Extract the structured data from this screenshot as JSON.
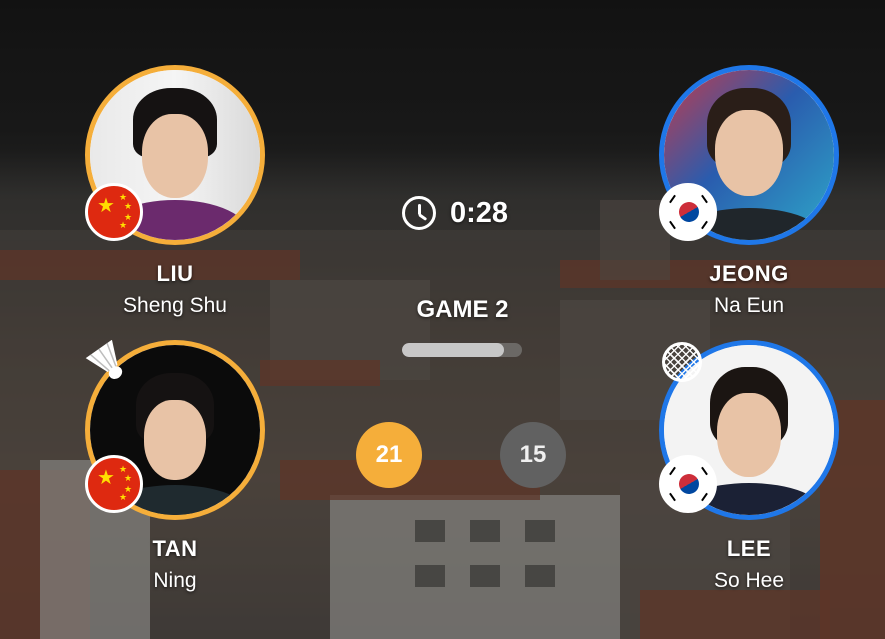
{
  "match": {
    "timer": "0:28",
    "game_label": "GAME 2",
    "game_progress_fraction": 0.85
  },
  "team_a": {
    "score": "21",
    "score_color": "#f5ae3a",
    "ring_color": "#f5ae3a",
    "players": [
      {
        "surname": "LIU",
        "given_name": "Sheng Shu",
        "flag": "china-flag"
      },
      {
        "surname": "TAN",
        "given_name": "Ning",
        "flag": "china-flag",
        "serving": true
      }
    ]
  },
  "team_b": {
    "score": "15",
    "score_color": "#616161",
    "ring_color": "#1f77e8",
    "players": [
      {
        "surname": "JEONG",
        "given_name": "Na Eun",
        "flag": "south-korea-flag"
      },
      {
        "surname": "LEE",
        "given_name": "So Hee",
        "flag": "south-korea-flag",
        "receiving": true
      }
    ]
  },
  "icons": {
    "timer": "clock-icon",
    "server": "shuttlecock-icon",
    "receiver": "racket-icon"
  }
}
